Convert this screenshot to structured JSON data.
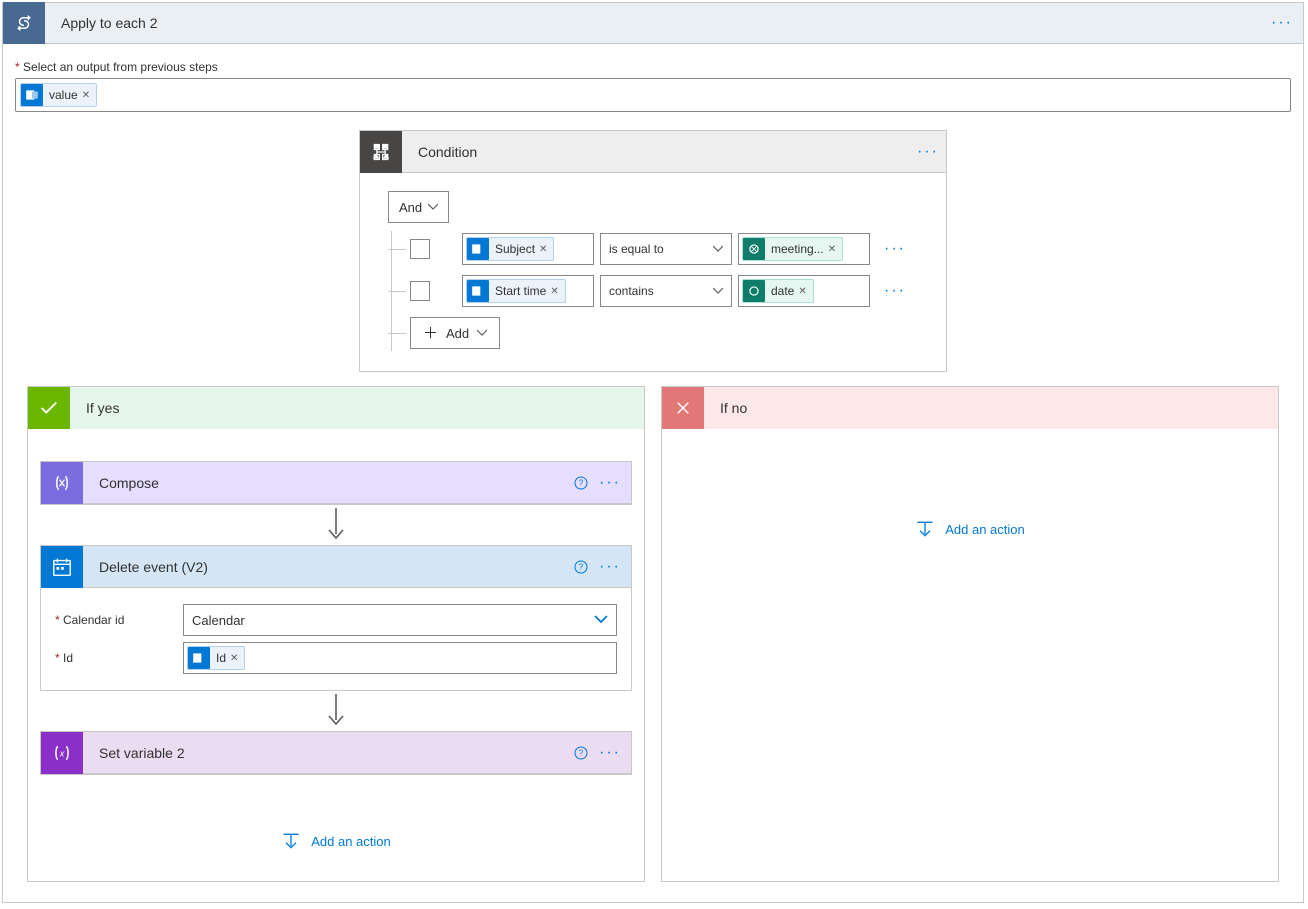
{
  "outer": {
    "title": "Apply to each 2"
  },
  "field": {
    "select_output_label": "Select an output from previous steps",
    "value_token": "value"
  },
  "condition": {
    "title": "Condition",
    "combiner": "And",
    "add_label": "Add",
    "rows": [
      {
        "left": "Subject",
        "op": "is equal to",
        "right": "meeting..."
      },
      {
        "left": "Start time",
        "op": "contains",
        "right": "date"
      }
    ]
  },
  "yes": {
    "title": "If yes",
    "compose_title": "Compose",
    "delete_title": "Delete event (V2)",
    "delete_calendar_label": "Calendar id",
    "delete_calendar_value": "Calendar",
    "delete_id_label": "Id",
    "delete_id_token": "Id",
    "setvar_title": "Set variable 2",
    "add_action": "Add an action"
  },
  "no": {
    "title": "If no",
    "add_action": "Add an action"
  }
}
